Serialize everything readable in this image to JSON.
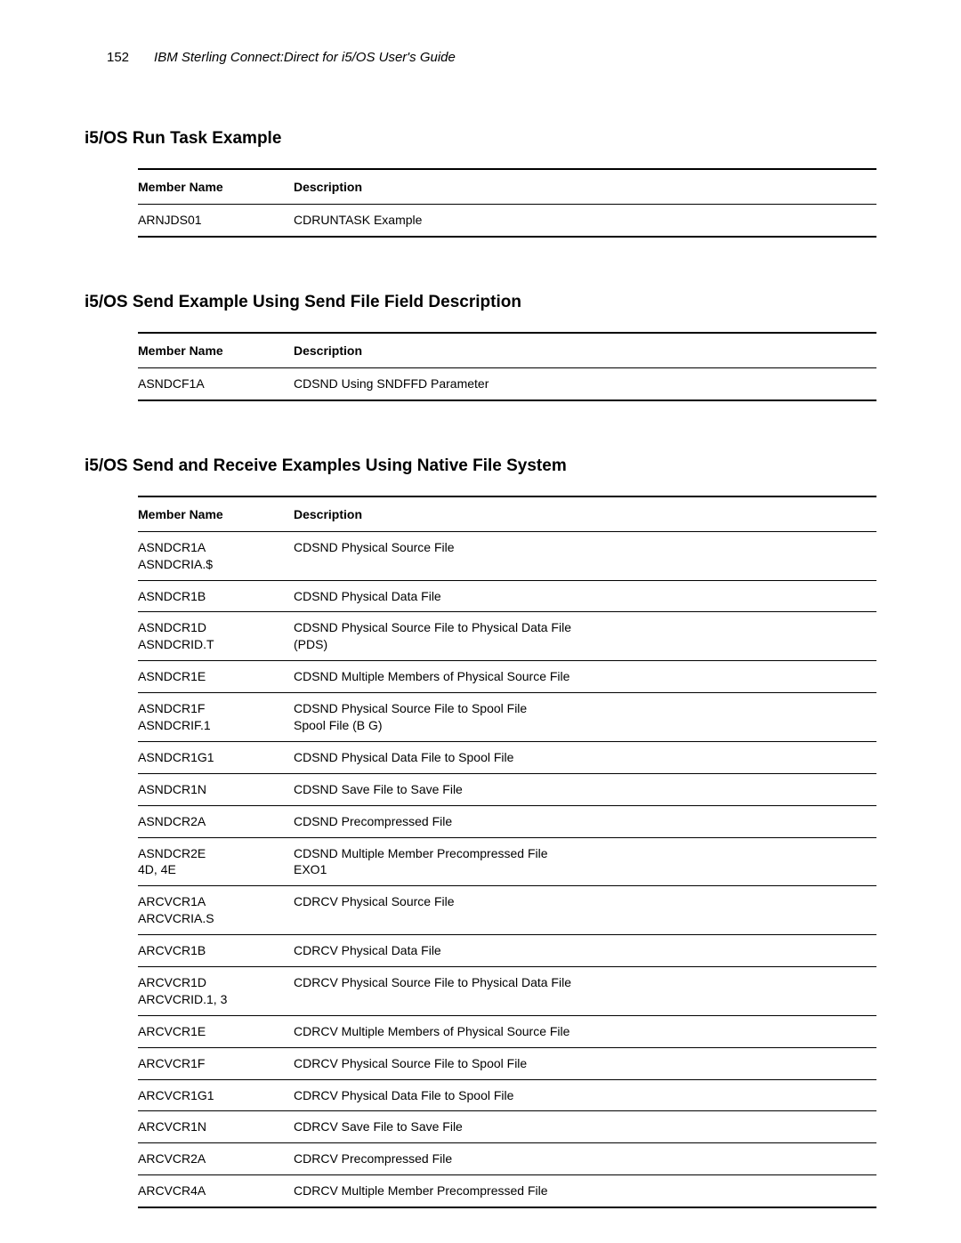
{
  "header": {
    "page_number": "152",
    "doc_title": "IBM Sterling Connect:Direct for i5/OS User's Guide"
  },
  "section1": {
    "heading": "i5/OS Run Task Example",
    "col_member": "Member Name",
    "col_desc": "Description",
    "rows": [
      {
        "member": "ARNJDS01",
        "desc": "CDRUNTASK Example"
      }
    ]
  },
  "section2": {
    "heading": "i5/OS Send Example Using Send File Field Description",
    "col_member": "Member Name",
    "col_desc": "Description",
    "rows": [
      {
        "member": "ASNDCF1A",
        "desc": "CDSND Using SNDFFD Parameter"
      }
    ]
  },
  "section3": {
    "heading": "i5/OS Send and Receive Examples Using Native File System",
    "col_member": "Member Name",
    "col_desc": "Description",
    "rows": [
      {
        "member": "ASNDCR1A\nASNDCRIA.$",
        "desc": "CDSND Physical Source File"
      },
      {
        "member": "ASNDCR1B",
        "desc": "CDSND Physical Data File"
      },
      {
        "member": "ASNDCR1D\nASNDCRID.T",
        "desc": "CDSND Physical Source File to Physical Data File\n(PDS)"
      },
      {
        "member": "ASNDCR1E",
        "desc": "CDSND Multiple Members of Physical Source File"
      },
      {
        "member": "ASNDCR1F\nASNDCRIF.1",
        "desc": "CDSND Physical Source File to Spool File\nSpool File (B G)"
      },
      {
        "member": "ASNDCR1G1",
        "desc": "CDSND Physical Data File to Spool File"
      },
      {
        "member": "ASNDCR1N",
        "desc": "CDSND Save File to Save File"
      },
      {
        "member": "ASNDCR2A",
        "desc": "CDSND Precompressed File"
      },
      {
        "member": "ASNDCR2E\n4D, 4E",
        "desc": "CDSND Multiple Member Precompressed File\nEXO1"
      },
      {
        "member": "ARCVCR1A\nARCVCRIA.S",
        "desc": "CDRCV Physical Source File"
      },
      {
        "member": "ARCVCR1B",
        "desc": "CDRCV Physical Data File"
      },
      {
        "member": "ARCVCR1D\nARCVCRID.1, 3",
        "desc": "CDRCV Physical Source File to Physical Data File"
      },
      {
        "member": "ARCVCR1E",
        "desc": "CDRCV Multiple Members of Physical Source File"
      },
      {
        "member": "ARCVCR1F",
        "desc": "CDRCV Physical Source File to Spool File"
      },
      {
        "member": "ARCVCR1G1",
        "desc": "CDRCV Physical Data File to Spool File"
      },
      {
        "member": "ARCVCR1N",
        "desc": "CDRCV Save File to Save File"
      },
      {
        "member": "ARCVCR2A",
        "desc": "CDRCV Precompressed File"
      },
      {
        "member": "ARCVCR4A",
        "desc": "CDRCV Multiple Member Precompressed File"
      }
    ]
  }
}
